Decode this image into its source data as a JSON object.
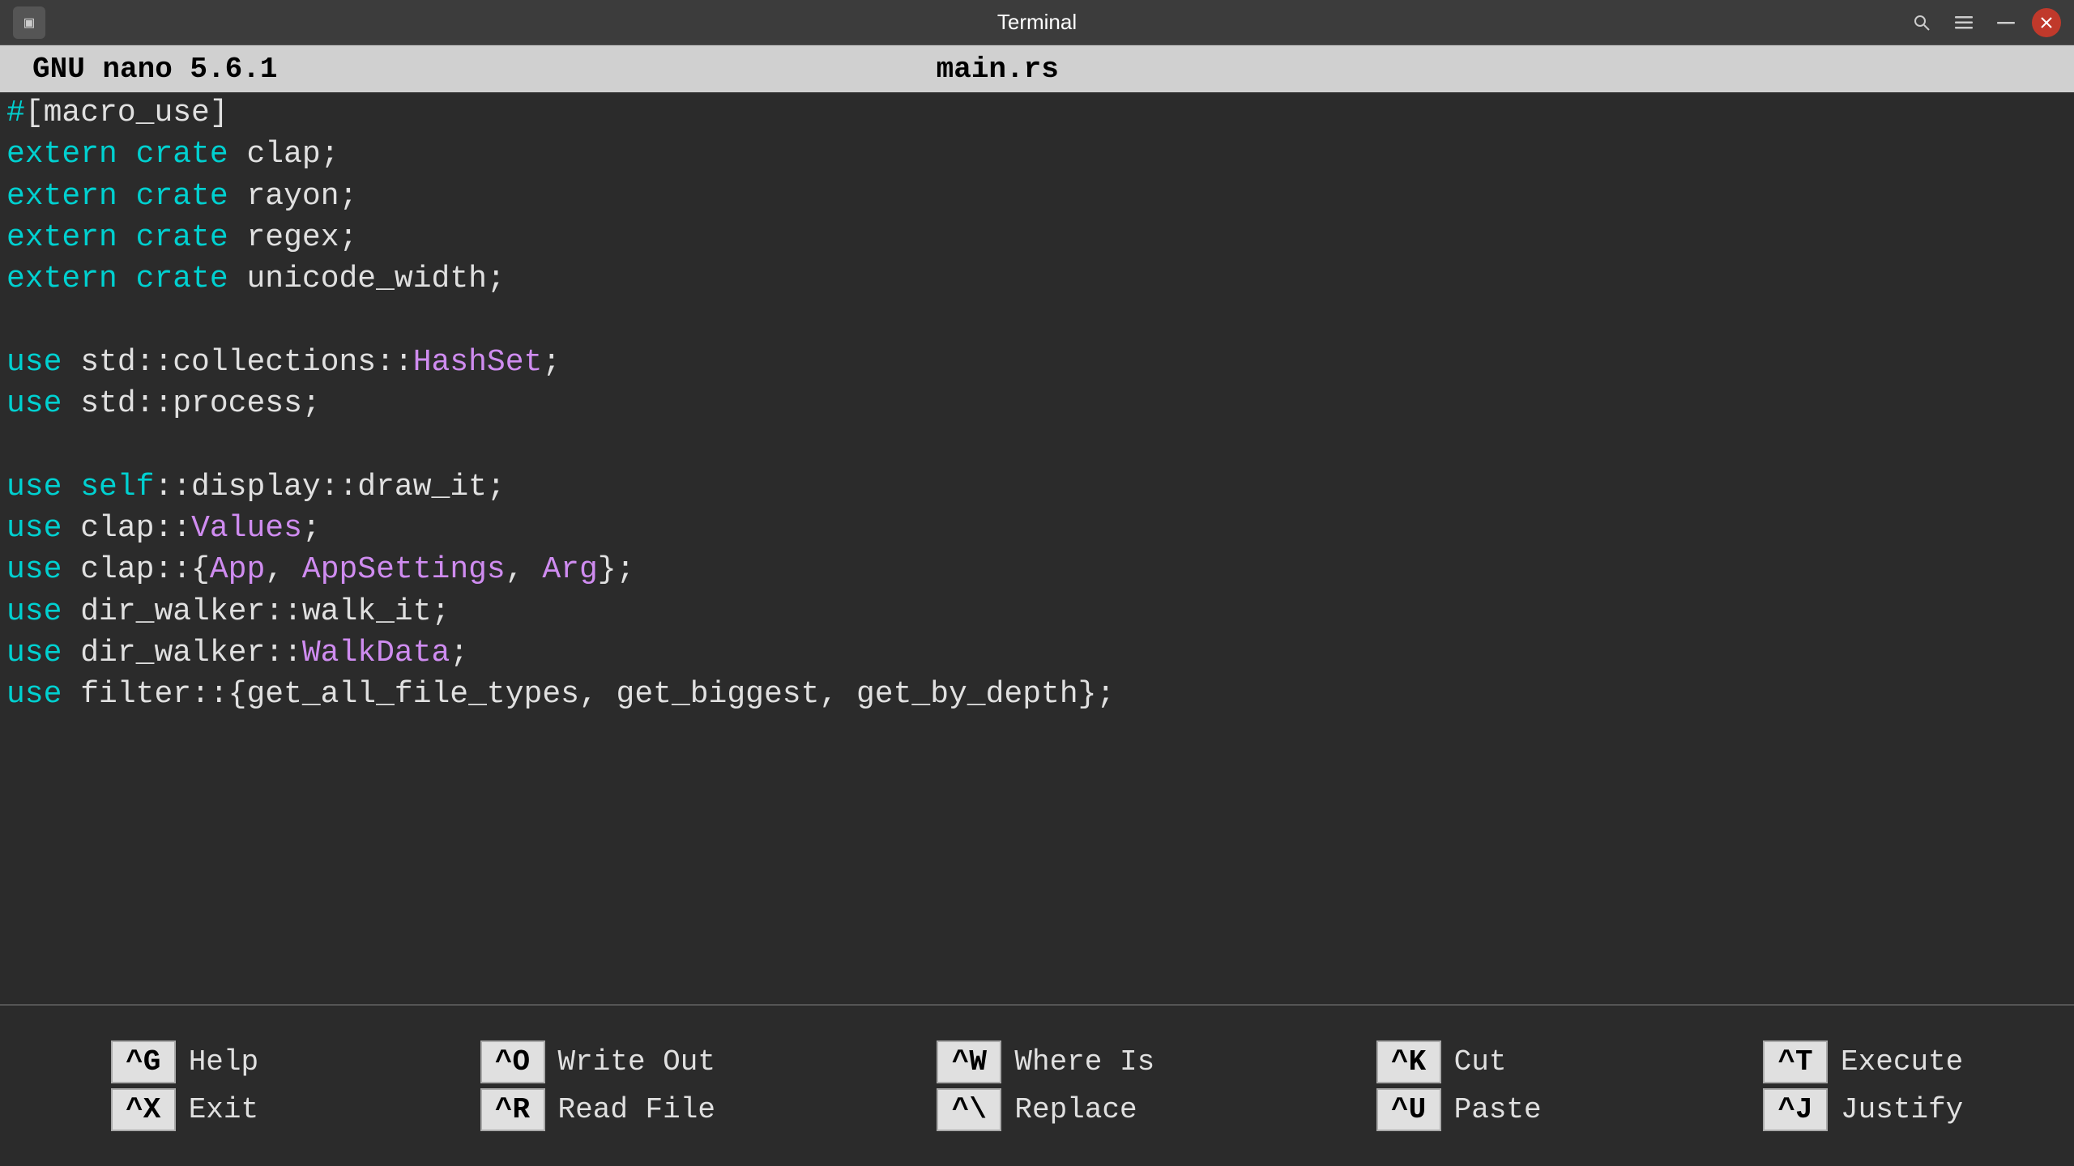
{
  "titlebar": {
    "title": "Terminal",
    "app_icon": "▣"
  },
  "nano_header": {
    "left": "GNU nano 5.6.1",
    "filename": "main.rs"
  },
  "editor": {
    "lines": [
      {
        "id": 1,
        "text": "#[macro_use]",
        "parts": [
          {
            "text": "#",
            "class": "c-teal"
          },
          {
            "text": "[macro_use]",
            "class": "c-white"
          }
        ]
      },
      {
        "id": 2,
        "text": "extern crate clap;",
        "parts": [
          {
            "text": "extern",
            "class": "c-cyan"
          },
          {
            "text": " ",
            "class": "c-white"
          },
          {
            "text": "crate",
            "class": "c-cyan"
          },
          {
            "text": " clap;",
            "class": "c-white"
          }
        ]
      },
      {
        "id": 3,
        "text": "extern crate rayon;",
        "parts": [
          {
            "text": "extern",
            "class": "c-cyan"
          },
          {
            "text": " ",
            "class": "c-white"
          },
          {
            "text": "crate",
            "class": "c-cyan"
          },
          {
            "text": " rayon;",
            "class": "c-white"
          }
        ]
      },
      {
        "id": 4,
        "text": "extern crate regex;",
        "parts": [
          {
            "text": "extern",
            "class": "c-cyan"
          },
          {
            "text": " ",
            "class": "c-white"
          },
          {
            "text": "crate",
            "class": "c-cyan"
          },
          {
            "text": " regex;",
            "class": "c-white"
          }
        ]
      },
      {
        "id": 5,
        "text": "extern crate unicode_width;",
        "parts": [
          {
            "text": "extern",
            "class": "c-cyan"
          },
          {
            "text": " ",
            "class": "c-white"
          },
          {
            "text": "crate",
            "class": "c-cyan"
          },
          {
            "text": " unicode_width;",
            "class": "c-white"
          }
        ]
      },
      {
        "id": 6,
        "text": "",
        "parts": []
      },
      {
        "id": 7,
        "text": "use std::collections::HashSet;",
        "parts": [
          {
            "text": "use",
            "class": "c-cyan"
          },
          {
            "text": " std::collections::",
            "class": "c-white"
          },
          {
            "text": "HashSet",
            "class": "c-purple"
          },
          {
            "text": ";",
            "class": "c-white"
          }
        ]
      },
      {
        "id": 8,
        "text": "use std::process;",
        "parts": [
          {
            "text": "use",
            "class": "c-cyan"
          },
          {
            "text": " std::process;",
            "class": "c-white"
          }
        ]
      },
      {
        "id": 9,
        "text": "",
        "parts": []
      },
      {
        "id": 10,
        "text": "use self::display::draw_it;",
        "parts": [
          {
            "text": "use",
            "class": "c-cyan"
          },
          {
            "text": " ",
            "class": "c-white"
          },
          {
            "text": "self",
            "class": "c-cyan"
          },
          {
            "text": "::display::draw_it;",
            "class": "c-white"
          }
        ]
      },
      {
        "id": 11,
        "text": "use clap::Values;",
        "parts": [
          {
            "text": "use",
            "class": "c-cyan"
          },
          {
            "text": " clap::",
            "class": "c-white"
          },
          {
            "text": "Values",
            "class": "c-purple"
          },
          {
            "text": ";",
            "class": "c-white"
          }
        ]
      },
      {
        "id": 12,
        "text": "use clap::{App, AppSettings, Arg};",
        "parts": [
          {
            "text": "use",
            "class": "c-cyan"
          },
          {
            "text": " clap::{",
            "class": "c-white"
          },
          {
            "text": "App",
            "class": "c-purple"
          },
          {
            "text": ", ",
            "class": "c-white"
          },
          {
            "text": "AppSettings",
            "class": "c-purple"
          },
          {
            "text": ", ",
            "class": "c-white"
          },
          {
            "text": "Arg",
            "class": "c-purple"
          },
          {
            "text": "};",
            "class": "c-white"
          }
        ]
      },
      {
        "id": 13,
        "text": "use dir_walker::walk_it;",
        "parts": [
          {
            "text": "use",
            "class": "c-cyan"
          },
          {
            "text": " dir_walker::walk_it;",
            "class": "c-white"
          }
        ]
      },
      {
        "id": 14,
        "text": "use dir_walker::WalkData;",
        "parts": [
          {
            "text": "use",
            "class": "c-cyan"
          },
          {
            "text": " dir_walker::",
            "class": "c-white"
          },
          {
            "text": "WalkData",
            "class": "c-purple"
          },
          {
            "text": ";",
            "class": "c-white"
          }
        ]
      },
      {
        "id": 15,
        "text": "use filter::{get_all_file_types, get_biggest, get_by_depth};",
        "parts": [
          {
            "text": "use",
            "class": "c-cyan"
          },
          {
            "text": " filter::{get_all_file_types, get_biggest, get_by_depth};",
            "class": "c-white"
          }
        ]
      }
    ]
  },
  "shortcuts": {
    "rows": [
      [
        {
          "key": "^G",
          "label": "Help"
        },
        {
          "key": "^X",
          "label": "Exit"
        }
      ],
      [
        {
          "key": "^O",
          "label": "Write Out"
        },
        {
          "key": "^R",
          "label": "Read File"
        }
      ],
      [
        {
          "key": "^W",
          "label": "Where Is"
        },
        {
          "key": "^\\",
          "label": "Replace"
        }
      ],
      [
        {
          "key": "^K",
          "label": "Cut"
        },
        {
          "key": "^U",
          "label": "Paste"
        }
      ],
      [
        {
          "key": "^T",
          "label": "Execute"
        },
        {
          "key": "^J",
          "label": "Justify"
        }
      ]
    ]
  }
}
